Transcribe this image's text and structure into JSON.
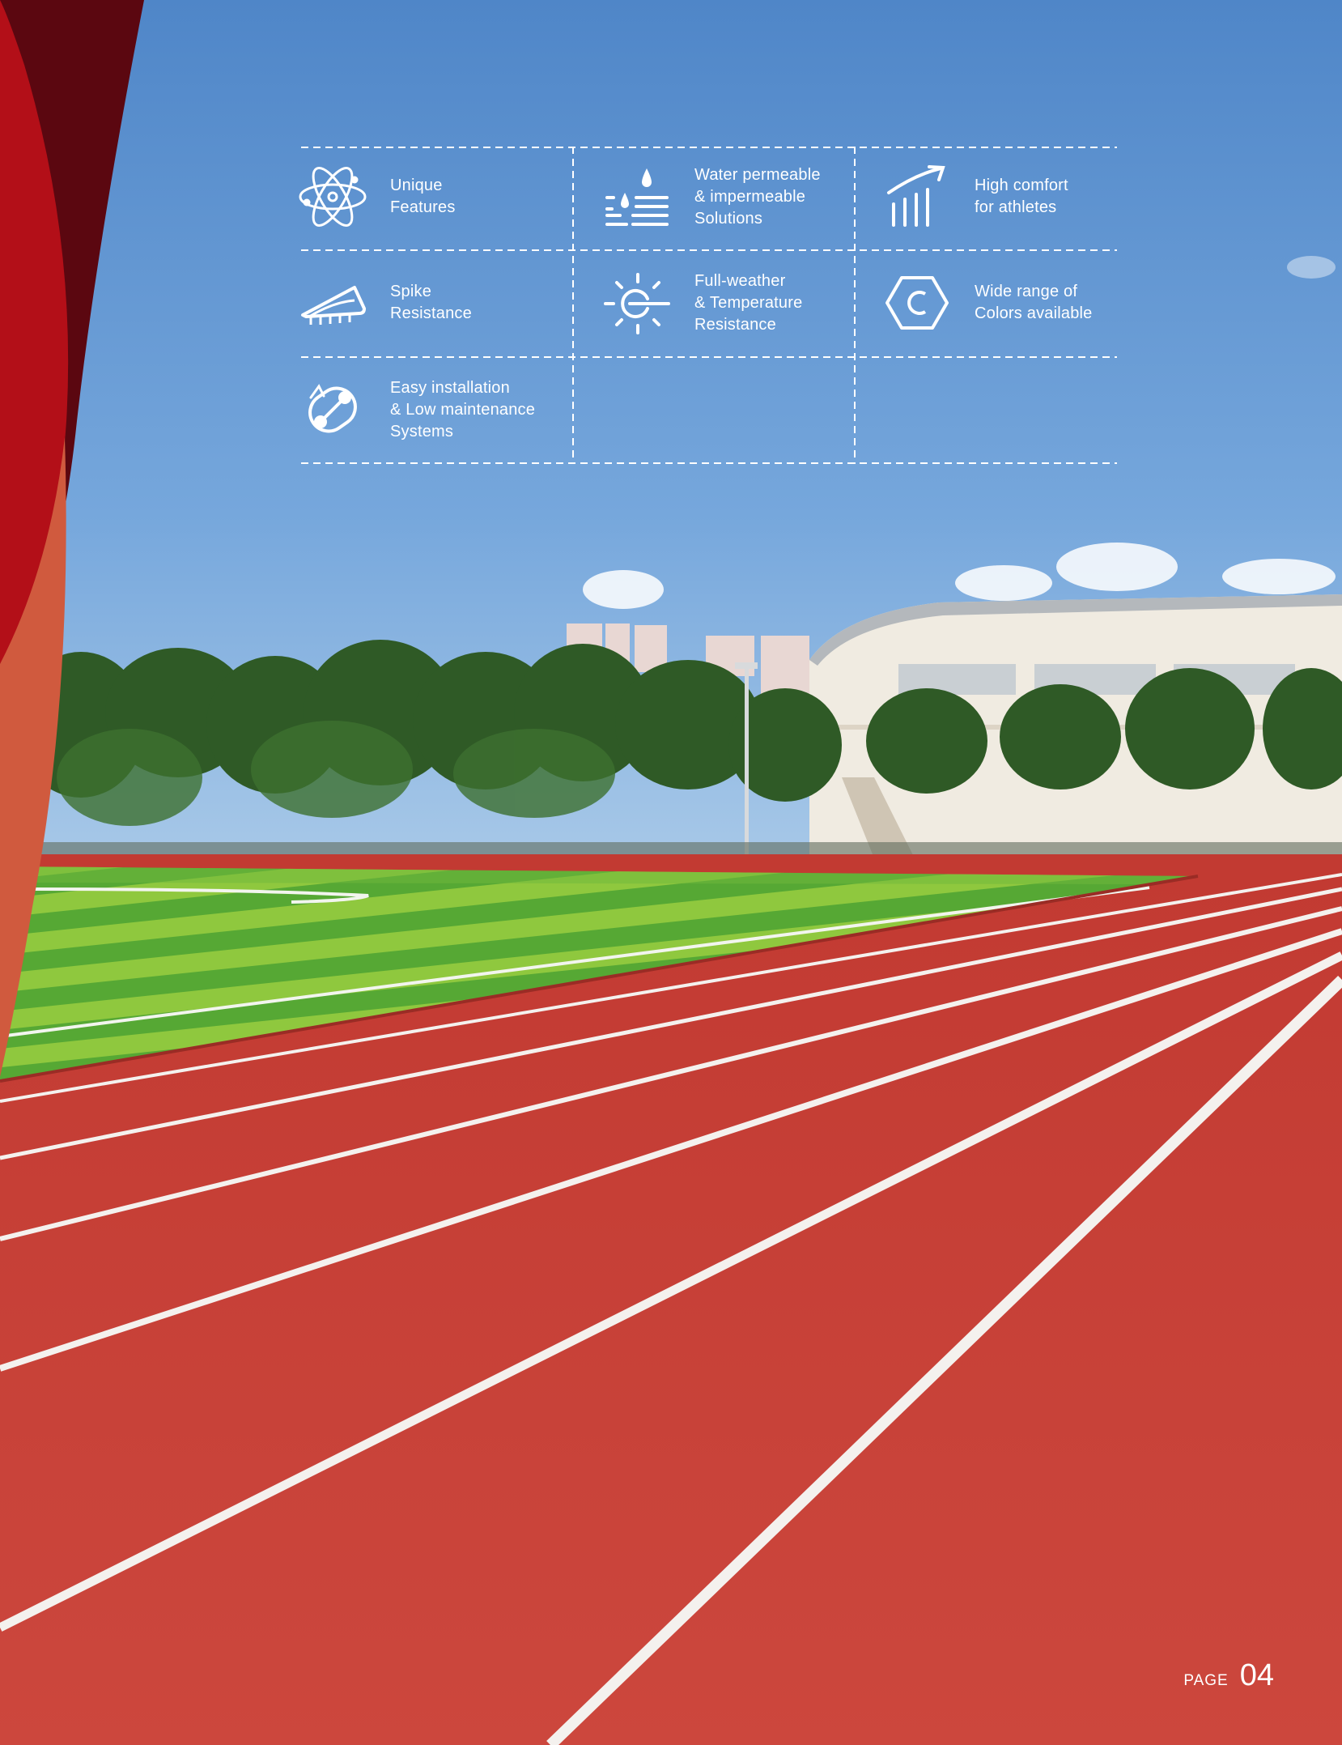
{
  "features": [
    {
      "icon": "atom-icon",
      "label": "Unique\nFeatures"
    },
    {
      "icon": "water-drop-icon",
      "label": "Water permeable\n& impermeable\nSolutions"
    },
    {
      "icon": "growth-chart-icon",
      "label": "High comfort\nfor athletes"
    },
    {
      "icon": "spike-shoe-icon",
      "label": "Spike\nResistance"
    },
    {
      "icon": "sun-weather-icon",
      "label": "Full-weather\n& Temperature\nResistance"
    },
    {
      "icon": "color-hexagon-icon",
      "label": "Wide range of\nColors available"
    },
    {
      "icon": "maintenance-cycle-icon",
      "label": "Easy installation\n& Low maintenance\nSystems"
    }
  ],
  "footer": {
    "page_label": "PAGE",
    "page_number": "04"
  },
  "colors": {
    "sky_top": "#4f86c8",
    "sky_bottom": "#9cc2e8",
    "track": "#c9403a",
    "turf_light": "#8ec63f",
    "turf_dark": "#4a9a2e",
    "ribbon_dark": "#6b0a12",
    "ribbon_red": "#b8141c",
    "ribbon_light": "#d65a3e"
  }
}
